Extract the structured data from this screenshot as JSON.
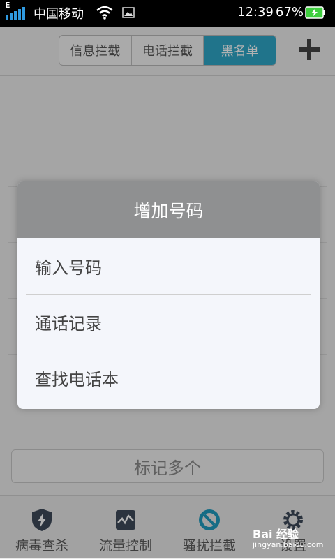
{
  "status_bar": {
    "network_type": "E",
    "carrier": "中国移动",
    "time": "12:39",
    "battery": "67%"
  },
  "header": {
    "tabs": [
      {
        "label": "信息拦截",
        "active": false
      },
      {
        "label": "电话拦截",
        "active": false
      },
      {
        "label": "黑名单",
        "active": true
      }
    ],
    "add_icon": "plus-icon"
  },
  "list": {
    "mark_button": "标记多个"
  },
  "bottom_nav": {
    "items": [
      {
        "label": "病毒查杀",
        "icon": "shield-bolt-icon"
      },
      {
        "label": "流量控制",
        "icon": "traffic-chart-icon"
      },
      {
        "label": "骚扰拦截",
        "icon": "block-icon"
      },
      {
        "label": "设置",
        "icon": "gear-icon"
      }
    ]
  },
  "dialog": {
    "title": "增加号码",
    "options": [
      "输入号码",
      "通话记录",
      "查找电话本"
    ]
  },
  "watermark": {
    "brand": "Bai 经验",
    "url": "jingyan.baidu.com"
  },
  "colors": {
    "accent": "#2ea6c7",
    "dialog_title_bg": "#8f9091",
    "battery_green": "#3fcf3f"
  }
}
